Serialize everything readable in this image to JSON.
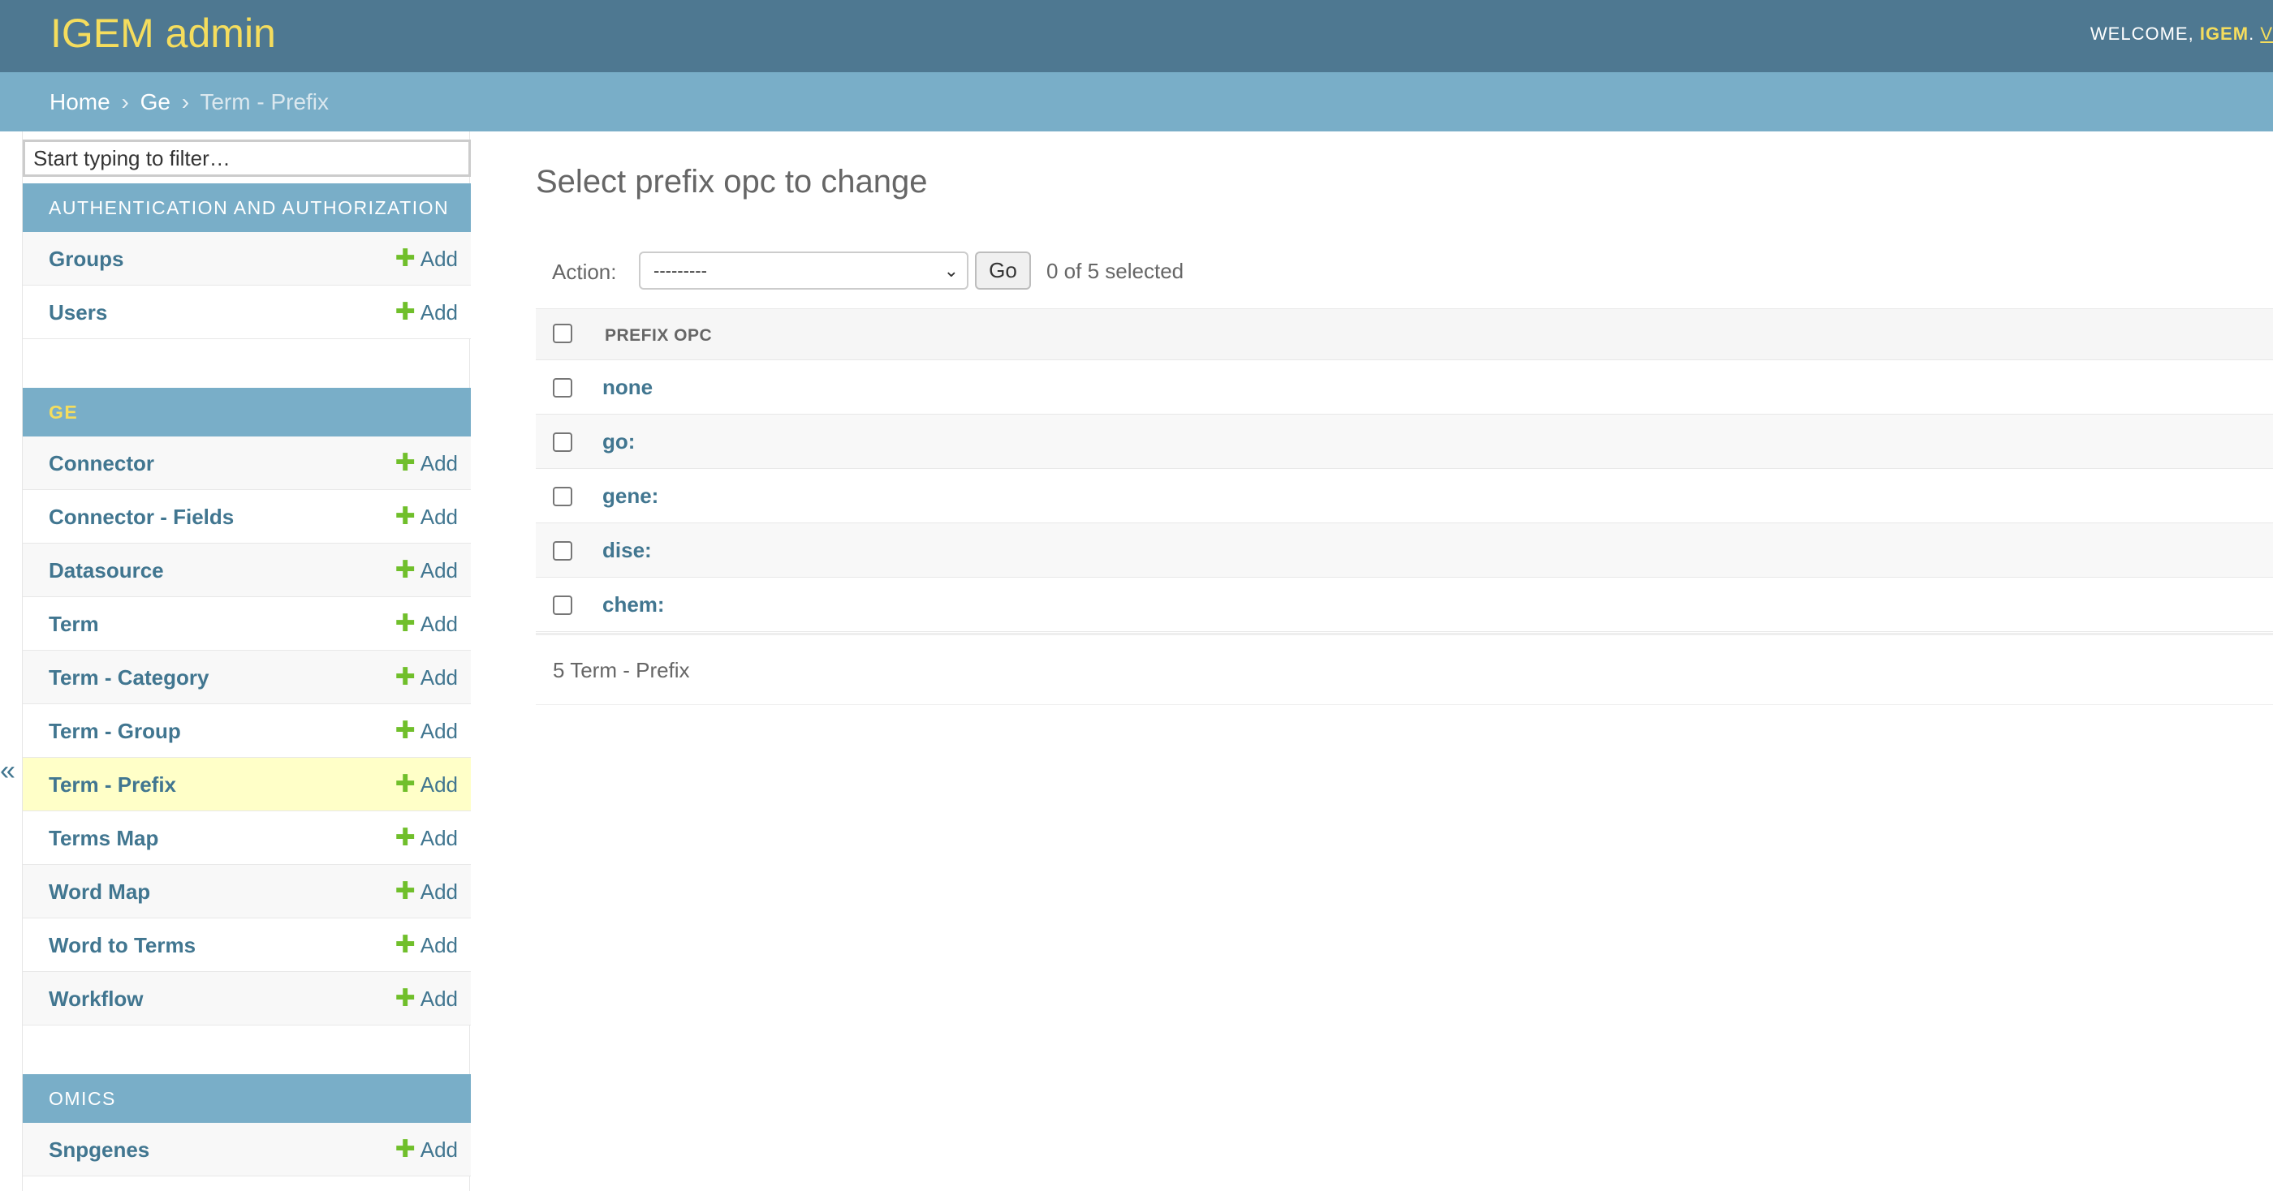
{
  "header": {
    "brand": "IGEM admin",
    "welcome_label": "WELCOME,",
    "username": "IGEM",
    "separator": ".",
    "view_site_truncated": "V"
  },
  "breadcrumbs": {
    "home": "Home",
    "app": "Ge",
    "current": "Term - Prefix",
    "arrow": "›"
  },
  "sidebar": {
    "filter_placeholder": "Start typing to filter…",
    "collapse_toggle": "«",
    "add_label": "Add",
    "add_icon": "plus-icon",
    "modules": [
      {
        "caption": "AUTHENTICATION AND AUTHORIZATION",
        "models": [
          {
            "name": "Groups"
          },
          {
            "name": "Users"
          }
        ]
      },
      {
        "caption": "GE",
        "models": [
          {
            "name": "Connector"
          },
          {
            "name": "Connector - Fields"
          },
          {
            "name": "Datasource"
          },
          {
            "name": "Term"
          },
          {
            "name": "Term - Category"
          },
          {
            "name": "Term - Group"
          },
          {
            "name": "Term - Prefix",
            "current": true
          },
          {
            "name": "Terms Map"
          },
          {
            "name": "Word Map"
          },
          {
            "name": "Word to Terms"
          },
          {
            "name": "Workflow"
          }
        ]
      },
      {
        "caption": "OMICS",
        "models": [
          {
            "name": "Snpgenes"
          }
        ]
      }
    ]
  },
  "content": {
    "title": "Select prefix opc to change",
    "actions": {
      "label": "Action:",
      "selected_option": "---------",
      "go_label": "Go",
      "counter": "0 of 5 selected"
    },
    "table": {
      "column": "PREFIX OPC",
      "rows": [
        "none",
        "go:",
        "gene:",
        "dise:",
        "chem:"
      ]
    },
    "paginator": "5 Term - Prefix"
  },
  "colors": {
    "header_bg": "#4e7891",
    "breadcrumbs_bg": "#79aec8",
    "brand": "#f5dd5d",
    "link": "#417690",
    "add_plus": "#70bf2b",
    "current_row": "#ffffc8"
  }
}
